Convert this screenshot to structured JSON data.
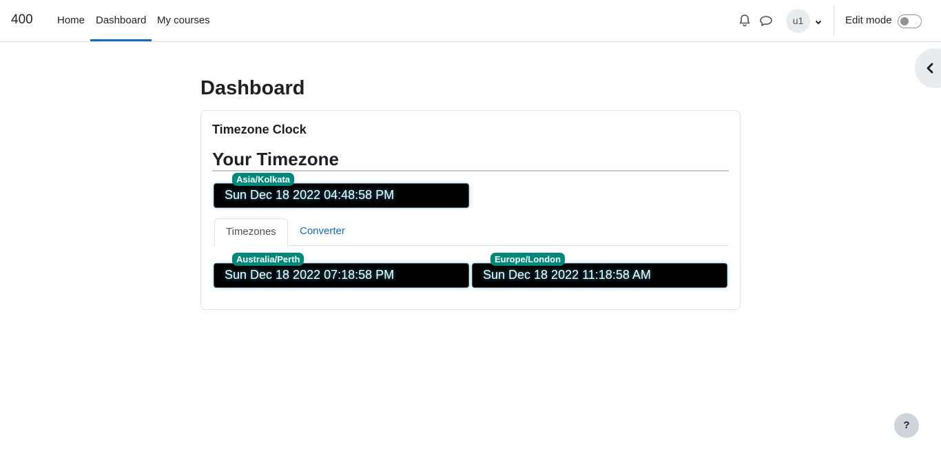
{
  "navbar": {
    "brand": "400",
    "links": {
      "home": "Home",
      "dashboard": "Dashboard",
      "my_courses": "My courses"
    },
    "icons": {
      "notifications": "bell-icon",
      "messages": "chat-icon"
    },
    "user_initials": "u1",
    "edit_mode_label": "Edit mode",
    "edit_mode_on": false
  },
  "page": {
    "title": "Dashboard"
  },
  "block": {
    "title": "Timezone Clock",
    "your_timezone_heading": "Your Timezone",
    "main_clock": {
      "zone": "Asia/Kolkata",
      "time": "Sun Dec 18 2022 04:48:58 PM"
    },
    "tabs": {
      "timezones": "Timezones",
      "converter": "Converter",
      "active": "Timezones"
    },
    "clocks": [
      {
        "zone": "Australia/Perth",
        "time": "Sun Dec 18 2022 07:18:58 PM"
      },
      {
        "zone": "Europe/London",
        "time": "Sun Dec 18 2022 11:18:58 AM"
      }
    ]
  },
  "help_button": "?",
  "colors": {
    "accent": "#0f6cbf",
    "badge": "#00897b",
    "clock_bg": "#000000"
  }
}
